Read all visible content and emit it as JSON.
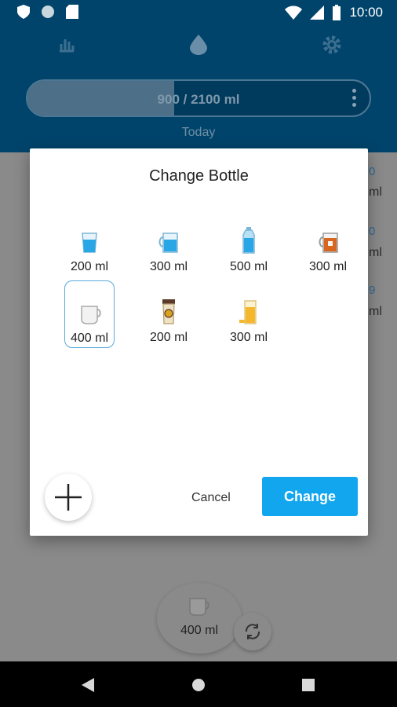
{
  "status": {
    "time": "10:00"
  },
  "progress": {
    "text": "900 / 2100 ml",
    "fraction": 0.43,
    "period": "Today"
  },
  "background": {
    "nums": [
      "0",
      "0",
      "9"
    ],
    "mls": [
      "ml",
      "ml",
      "ml"
    ]
  },
  "fab": {
    "label": "400 ml"
  },
  "dialog": {
    "title": "Change Bottle",
    "bottles": [
      {
        "label": "200 ml",
        "icon": "glass-icon"
      },
      {
        "label": "300 ml",
        "icon": "mug-icon"
      },
      {
        "label": "500 ml",
        "icon": "bottle-icon"
      },
      {
        "label": "300 ml",
        "icon": "tea-mug-icon"
      },
      {
        "label": "400 ml",
        "icon": "cup-icon"
      },
      {
        "label": "200 ml",
        "icon": "coffee-cup-icon"
      },
      {
        "label": "300 ml",
        "icon": "juice-glass-icon"
      }
    ],
    "selected": 4,
    "cancel_label": "Cancel",
    "change_label": "Change"
  },
  "colors": {
    "accent": "#12a6ee",
    "header": "#00446b",
    "selection": "#5aa9dc"
  }
}
